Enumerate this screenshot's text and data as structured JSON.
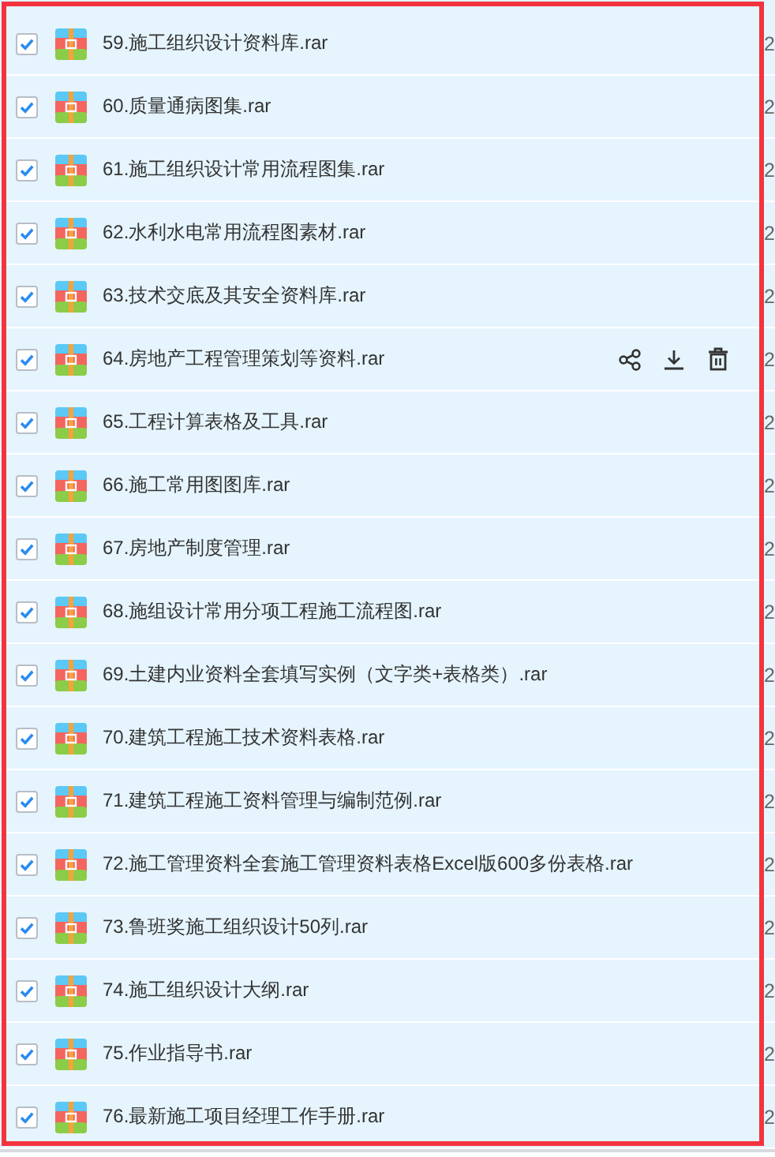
{
  "files": [
    {
      "name": "59.施工组织设计资料库.rar",
      "column_2": "2",
      "checked": true,
      "show_actions": false
    },
    {
      "name": "60.质量通病图集.rar",
      "column_2": "2",
      "checked": true,
      "show_actions": false
    },
    {
      "name": "61.施工组织设计常用流程图集.rar",
      "column_2": "2",
      "checked": true,
      "show_actions": false
    },
    {
      "name": "62.水利水电常用流程图素材.rar",
      "column_2": "2",
      "checked": true,
      "show_actions": false
    },
    {
      "name": "63.技术交底及其安全资料库.rar",
      "column_2": "2",
      "checked": true,
      "show_actions": false
    },
    {
      "name": "64.房地产工程管理策划等资料.rar",
      "column_2": "2",
      "checked": true,
      "show_actions": true
    },
    {
      "name": "65.工程计算表格及工具.rar",
      "column_2": "2",
      "checked": true,
      "show_actions": false
    },
    {
      "name": "66.施工常用图图库.rar",
      "column_2": "2",
      "checked": true,
      "show_actions": false
    },
    {
      "name": "67.房地产制度管理.rar",
      "column_2": "2",
      "checked": true,
      "show_actions": false
    },
    {
      "name": "68.施组设计常用分项工程施工流程图.rar",
      "column_2": "2",
      "checked": true,
      "show_actions": false
    },
    {
      "name": "69.土建内业资料全套填写实例（文字类+表格类）.rar",
      "column_2": "2",
      "checked": true,
      "show_actions": false
    },
    {
      "name": "70.建筑工程施工技术资料表格.rar",
      "column_2": "2",
      "checked": true,
      "show_actions": false
    },
    {
      "name": "71.建筑工程施工资料管理与编制范例.rar",
      "column_2": "2",
      "checked": true,
      "show_actions": false
    },
    {
      "name": "72.施工管理资料全套施工管理资料表格Excel版600多份表格.rar",
      "column_2": "2",
      "checked": true,
      "show_actions": false
    },
    {
      "name": "73.鲁班奖施工组织设计50列.rar",
      "column_2": "2",
      "checked": true,
      "show_actions": false
    },
    {
      "name": "74.施工组织设计大纲.rar",
      "column_2": "2",
      "checked": true,
      "show_actions": false
    },
    {
      "name": "75.作业指导书.rar",
      "column_2": "2",
      "checked": true,
      "show_actions": false
    },
    {
      "name": "76.最新施工项目经理工作手册.rar",
      "column_2": "2",
      "checked": true,
      "show_actions": false
    }
  ]
}
